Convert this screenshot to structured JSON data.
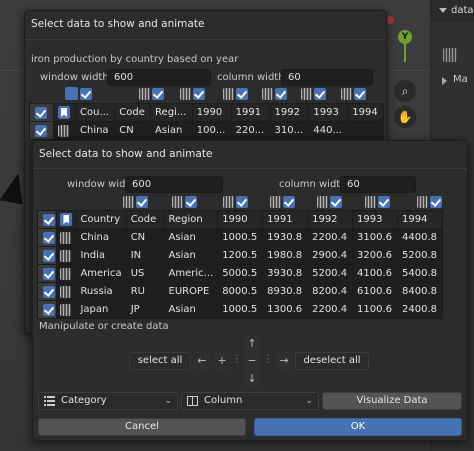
{
  "right_panel": {
    "header": "data",
    "item": "Ma"
  },
  "gizmo": {
    "axis_y": "Y"
  },
  "back_dialog": {
    "title": "Select data to show and animate",
    "subtitle": "iron production by country based on year",
    "window_width_label": "window width",
    "window_width_value": "600",
    "column_width_label": "column width",
    "column_width_value": "60",
    "headers": [
      "Cou...",
      "Code",
      "Regi...",
      "1990",
      "1991",
      "1992",
      "1993",
      "1994"
    ],
    "rows": [
      [
        "China",
        "CN",
        "Asian",
        "100...",
        "220...",
        "310...",
        "440..."
      ]
    ]
  },
  "front_dialog": {
    "title": "Select data to show and animate",
    "window_width_label": "window width",
    "window_width_value": "600",
    "column_width_label": "column width",
    "column_width_value": "60",
    "headers": [
      "Country",
      "Code",
      "Region",
      "1990",
      "1991",
      "1992",
      "1993",
      "1994"
    ],
    "rows": [
      [
        "China",
        "CN",
        "Asian",
        "1000.5",
        "1930.8",
        "2200.4",
        "3100.6",
        "4400.8"
      ],
      [
        "India",
        "IN",
        "Asian",
        "1200.5",
        "1980.8",
        "2900.4",
        "3200.6",
        "5200.8"
      ],
      [
        "America",
        "US",
        "Americ...",
        "5000.5",
        "3930.8",
        "5200.4",
        "4100.6",
        "5400.8"
      ],
      [
        "Russia",
        "RU",
        "EUROPE",
        "8000.5",
        "8930.8",
        "8200.4",
        "6100.6",
        "8400.8"
      ],
      [
        "Japan",
        "JP",
        "Asian",
        "1000.5",
        "1300.6",
        "2200.4",
        "1100.6",
        "2400.8"
      ]
    ],
    "manipulate_label": "Manipulate or create data",
    "select_all": "select all",
    "deselect_all": "deselect all",
    "arrow_left": "←",
    "plus": "+",
    "minus": "−",
    "arrow_right": "→",
    "arrow_up": "↑",
    "arrow_down": "↓",
    "category_dropdown": "Category",
    "column_dropdown": "Column",
    "visualize_button": "Visualize Data",
    "cancel_button": "Cancel",
    "ok_button": "OK"
  },
  "colors": {
    "accent": "#4772b3",
    "dialog_bg": "#2c2c2c",
    "cell_bg": "#1f1f1f"
  }
}
